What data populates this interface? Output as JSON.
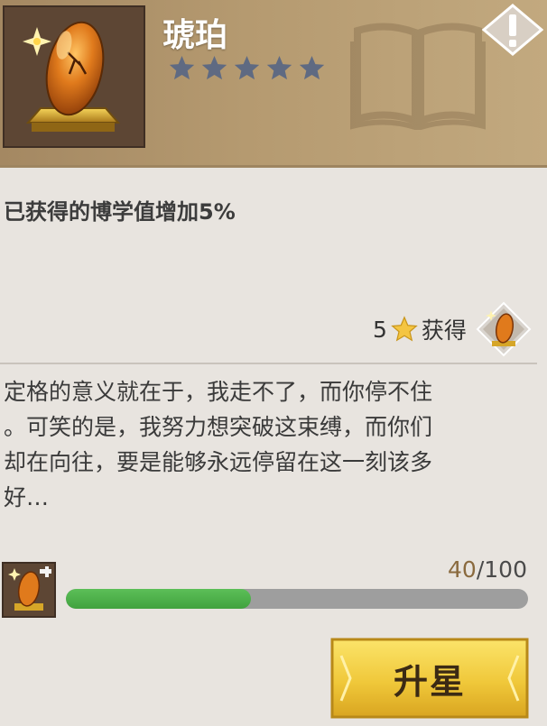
{
  "item": {
    "name": "琥珀",
    "star_count": 5,
    "star_color": "#5f6a82"
  },
  "effect_text": "已获得的博学值增加5%",
  "obtain": {
    "amount": "5",
    "label": "获得"
  },
  "description": "定格的意义就在于，我走不了，而你停不住\n。可笑的是，我努力想突破这束缚，而你们\n却在向往，要是能够永远停留在这一刻该多\n好…",
  "progress": {
    "current": "40",
    "max": "100",
    "separator": "/",
    "fraction": 0.4
  },
  "upgrade_button": {
    "label": "升星"
  },
  "colors": {
    "header": "#b59a70",
    "progress_fill": "#4cb049",
    "button_gold": "#f3d03a"
  },
  "icons": [
    "amber-item-icon",
    "star-icon",
    "book-watermark-icon",
    "exclamation-icon",
    "star-currency-icon",
    "amber-fragment-icon"
  ]
}
